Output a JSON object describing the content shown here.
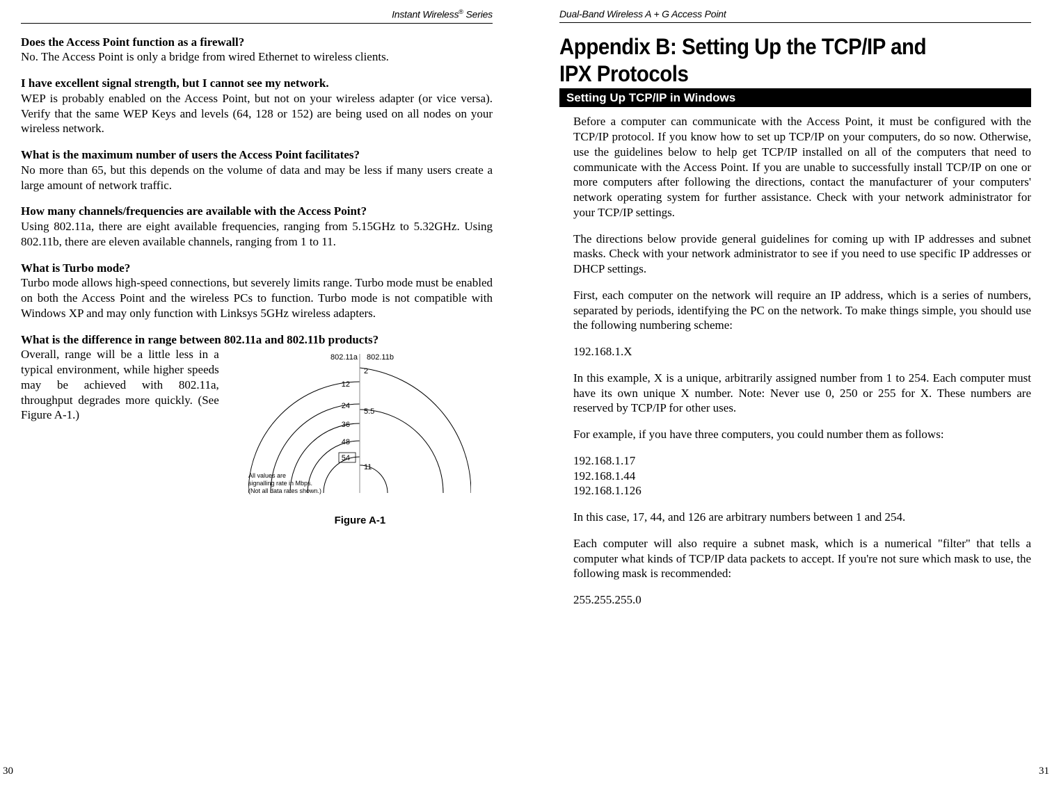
{
  "left": {
    "header": "Instant Wireless",
    "header_suffix": " Series",
    "tm": "®",
    "qa": [
      {
        "q": "Does the Access Point function as a firewall?",
        "a": "No. The Access Point is only a bridge from wired Ethernet to wireless clients."
      },
      {
        "q": "I have excellent signal strength, but I cannot see my network.",
        "a": "WEP is probably enabled on the Access Point, but not on your wireless adapter (or vice versa).  Verify that the same WEP Keys and levels (64, 128 or 152) are being used on all nodes on your wireless network."
      },
      {
        "q": "What is the maximum number of users the Access Point facilitates?",
        "a": "No more than 65, but this depends on the volume of data and may be less if many users create a large amount of network traffic."
      },
      {
        "q": "How many channels/frequencies are available with the Access Point?",
        "a": "Using 802.11a, there are eight available frequencies, ranging from 5.15GHz to 5.32GHz.  Using 802.11b, there are eleven available channels, ranging from 1 to 11."
      },
      {
        "q": "What is Turbo mode?",
        "a": "Turbo mode allows high-speed connections, but severely limits range.  Turbo mode must be enabled on both the Access Point and the wireless PCs to function.  Turbo mode is not compatible with Windows XP and may only function with Linksys 5GHz wireless adapters."
      },
      {
        "q": "What is the difference in range between 802.11a and 802.11b products?",
        "a": "Overall, range will be a little less in a typical environment, while higher speeds may be achieved with 802.11a, throughput degrades more quickly. (See Figure A-1.)"
      }
    ],
    "figure": {
      "caption": "Figure A-1",
      "label_a": "802.11a",
      "label_b": "802.11b",
      "note1": "All values are",
      "note2": "signalling rate in Mbps.",
      "note3": "(Not all data rates shown.)",
      "rings_a": [
        "12",
        "24",
        "36",
        "48",
        "54"
      ],
      "rings_b": [
        "2",
        "5.5",
        "11"
      ]
    },
    "page_number": "30"
  },
  "right": {
    "header": "Dual-Band Wireless A + G Access Point",
    "title_line1": "Appendix B: Setting Up the TCP/IP and",
    "title_line2": "IPX Protocols",
    "section_bar": "Setting Up TCP/IP in Windows",
    "paras": [
      "Before a computer can communicate with the Access Point, it must be configured with the TCP/IP protocol. If you know how to set up TCP/IP on your computers, do so now. Otherwise, use the guidelines below to help get TCP/IP installed on all of the computers that need to communicate with the Access Point. If you are unable to successfully install TCP/IP on one or more computers after following the directions, contact the manufacturer of your computers' network operating system for further assistance. Check with your network administrator for your TCP/IP settings.",
      "The directions below provide general guidelines for coming up with IP addresses and subnet masks. Check with your network administrator to see if you need to use specific IP addresses or DHCP settings.",
      "First, each computer on the network will require an IP address, which is a series of numbers, separated by periods, identifying the PC on the network. To make things simple, you should use the following numbering scheme:"
    ],
    "ip_scheme": "192.168.1.X",
    "paras2": [
      "In this example, X is a unique, arbitrarily assigned number from 1 to 254. Each computer must have its own unique X number. Note: Never use 0, 250 or 255 for X. These numbers are reserved by TCP/IP for other uses.",
      "For example, if you have three computers, you could number them as follows:"
    ],
    "ip_examples": [
      "192.168.1.17",
      "192.168.1.44",
      "192.168.1.126"
    ],
    "paras3": [
      "In this case, 17, 44, and 126 are arbitrary numbers between 1 and 254.",
      "Each computer will also require a subnet mask, which is a numerical \"filter\" that tells a computer what kinds of TCP/IP data packets to accept. If you're not sure which mask to use, the following mask is recommended:"
    ],
    "subnet": "255.255.255.0",
    "page_number": "31"
  },
  "chart_data": {
    "type": "other",
    "title": "Figure A-1",
    "description": "Concentric arcs comparing signalling rate (Mbps) vs range for 802.11a (left arcs) and 802.11b (right arcs).",
    "series": [
      {
        "name": "802.11a",
        "values": [
          12,
          24,
          36,
          48,
          54
        ]
      },
      {
        "name": "802.11b",
        "values": [
          2,
          5.5,
          11
        ]
      }
    ],
    "note": "All values are signalling rate in Mbps. (Not all data rates shown.)"
  }
}
